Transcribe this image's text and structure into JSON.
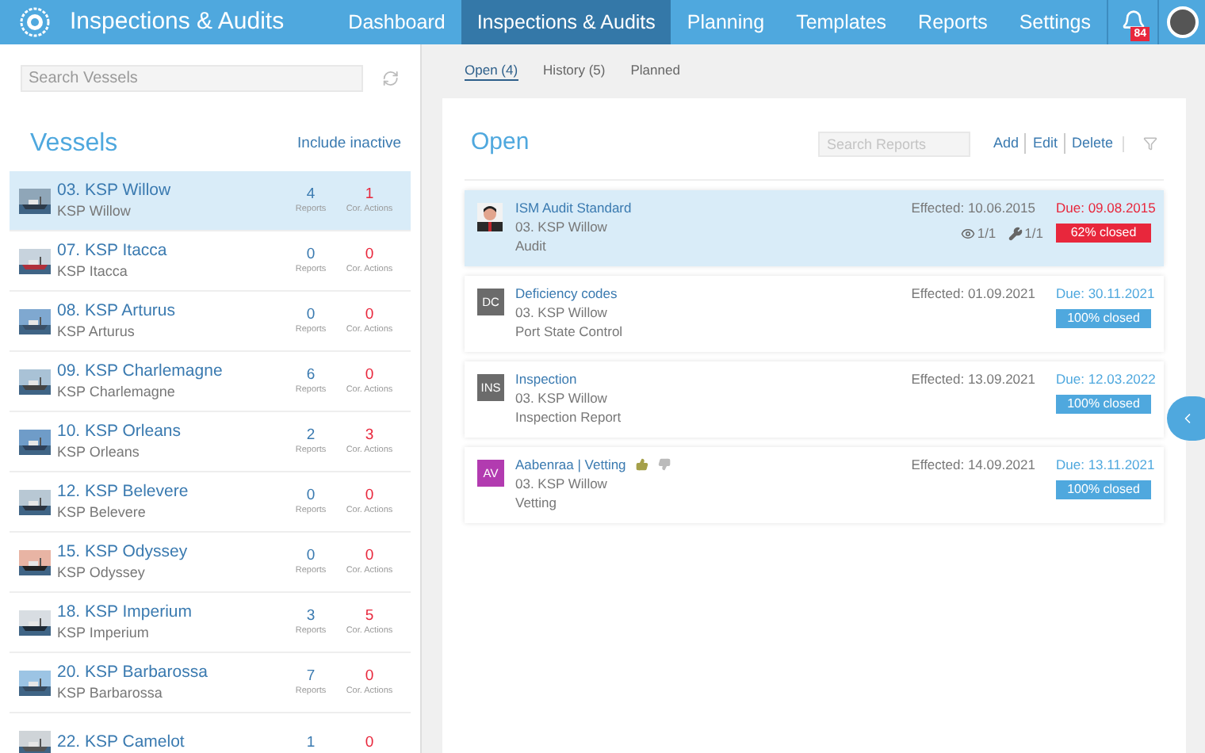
{
  "app": {
    "title": "Inspections & Audits"
  },
  "nav": [
    {
      "label": "Dashboard",
      "selected": false
    },
    {
      "label": "Inspections & Audits",
      "selected": true
    },
    {
      "label": "Planning",
      "selected": false
    },
    {
      "label": "Templates",
      "selected": false
    },
    {
      "label": "Reports",
      "selected": false
    },
    {
      "label": "Settings",
      "selected": false
    }
  ],
  "notifications": {
    "count": "84"
  },
  "sidebar": {
    "search": {
      "placeholder": "Search Vessels"
    },
    "title": "Vessels",
    "include_inactive": "Include inactive",
    "vessels": [
      {
        "name": "03. KSP Willow",
        "subtitle": "KSP Willow",
        "reports": "4",
        "reports_label": "Reports",
        "actions": "1",
        "actions_label": "Cor. Actions",
        "selected": true
      },
      {
        "name": "07. KSP Itacca",
        "subtitle": "KSP Itacca",
        "reports": "0",
        "reports_label": "Reports",
        "actions": "0",
        "actions_label": "Cor. Actions",
        "selected": false
      },
      {
        "name": "08. KSP Arturus",
        "subtitle": "KSP Arturus",
        "reports": "0",
        "reports_label": "Reports",
        "actions": "0",
        "actions_label": "Cor. Actions",
        "selected": false
      },
      {
        "name": "09. KSP Charlemagne",
        "subtitle": "KSP Charlemagne",
        "reports": "6",
        "reports_label": "Reports",
        "actions": "0",
        "actions_label": "Cor. Actions",
        "selected": false
      },
      {
        "name": "10. KSP Orleans",
        "subtitle": "KSP Orleans",
        "reports": "2",
        "reports_label": "Reports",
        "actions": "3",
        "actions_label": "Cor. Actions",
        "selected": false
      },
      {
        "name": "12. KSP Belevere",
        "subtitle": "KSP Belevere",
        "reports": "0",
        "reports_label": "Reports",
        "actions": "0",
        "actions_label": "Cor. Actions",
        "selected": false
      },
      {
        "name": "15. KSP Odyssey",
        "subtitle": "KSP Odyssey",
        "reports": "0",
        "reports_label": "Reports",
        "actions": "0",
        "actions_label": "Cor. Actions",
        "selected": false
      },
      {
        "name": "18. KSP Imperium",
        "subtitle": "KSP Imperium",
        "reports": "3",
        "reports_label": "Reports",
        "actions": "5",
        "actions_label": "Cor. Actions",
        "selected": false
      },
      {
        "name": "20. KSP Barbarossa",
        "subtitle": "KSP Barbarossa",
        "reports": "7",
        "reports_label": "Reports",
        "actions": "0",
        "actions_label": "Cor. Actions",
        "selected": false
      },
      {
        "name": "22. KSP Camelot",
        "reports": "1",
        "actions": "0",
        "selected": false
      }
    ]
  },
  "tabs": [
    {
      "label": "Open (4)",
      "selected": true
    },
    {
      "label": "History (5)",
      "selected": false
    },
    {
      "label": "Planned",
      "selected": false
    }
  ],
  "panel": {
    "title": "Open",
    "search": {
      "placeholder": "Search Reports"
    },
    "actions": [
      "Add",
      "Edit",
      "Delete"
    ],
    "reports": [
      {
        "title": "ISM Audit Standard",
        "vessel": "03. KSP Willow",
        "type": "Audit",
        "effected": "Effected: 10.06.2015",
        "due": "Due: 09.08.2015",
        "overdue": true,
        "views": "1/1",
        "tools": "1/1",
        "closed": "62% closed",
        "selected": true
      },
      {
        "title": "Deficiency codes",
        "vessel": "03. KSP Willow",
        "type": "Port State Control",
        "avatar": {
          "kind": "initials",
          "text": "DC",
          "color": "#6b6b6b"
        },
        "effected": "Effected: 01.09.2021",
        "due": "Due: 30.11.2021",
        "overdue": false,
        "closed": "100% closed",
        "selected": false
      },
      {
        "title": "Inspection",
        "vessel": "03. KSP Willow",
        "type": "Inspection Report",
        "avatar": {
          "kind": "initials",
          "text": "INS",
          "color": "#6b6b6b"
        },
        "effected": "Effected: 13.09.2021",
        "due": "Due: 12.03.2022",
        "overdue": false,
        "closed": "100% closed",
        "selected": false
      },
      {
        "title": "Aabenraa | Vetting",
        "vessel": "03. KSP Willow",
        "type": "Vetting",
        "avatar": {
          "kind": "initials",
          "text": "AV",
          "color": "#b23bb0"
        },
        "effected": "Effected: 14.09.2021",
        "due": "Due: 13.11.2021",
        "overdue": false,
        "closed": "100% closed",
        "selected": false,
        "rating": true
      }
    ]
  }
}
